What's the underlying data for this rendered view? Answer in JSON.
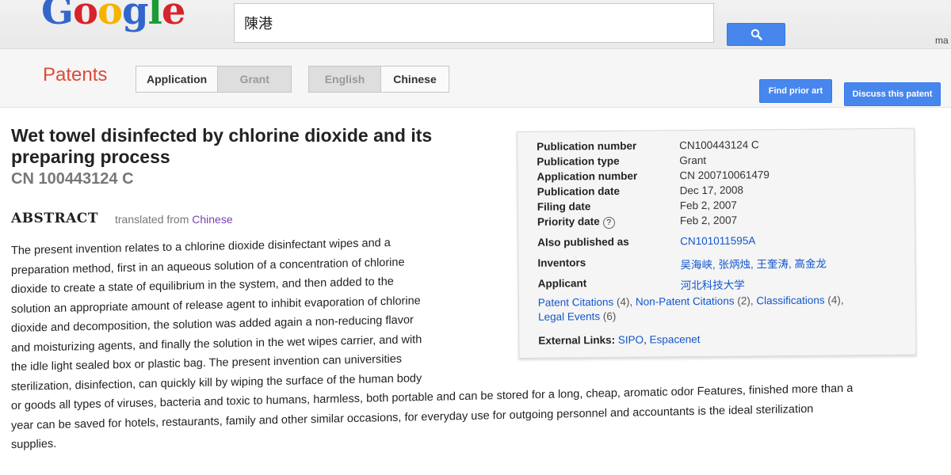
{
  "search": {
    "query": "陳港"
  },
  "header": {
    "user_text": "ma"
  },
  "subnav": {
    "section_title": "Patents",
    "doc_type_tabs": [
      "Application",
      "Grant"
    ],
    "language_tabs": [
      "English",
      "Chinese"
    ],
    "find_prior_art": "Find prior art",
    "discuss": "Discuss this patent"
  },
  "patent": {
    "title": "Wet towel disinfected by chlorine dioxide and its preparing process",
    "number": "CN 100443124 C",
    "abstract_heading": "ABSTRACT",
    "translated_from": "translated from",
    "source_language": "Chinese",
    "abstract_lines": [
      "The present invention relates to a chlorine dioxide disinfectant wipes and a",
      "preparation method, first in an aqueous solution of a concentration of chlorine",
      "dioxide to create a state of equilibrium in the system, and then added to the",
      "solution an appropriate amount of release agent to inhibit evaporation of chlorine",
      "dioxide and decomposition, the solution was added again a non-reducing flavor",
      "and moisturizing agents, and finally the solution in the wet wipes carrier, and with",
      "the idle light sealed box or plastic bag. The present invention can universities",
      "sterilization, disinfection, can quickly kill by wiping the surface of the human body",
      "or goods all types of viruses, bacteria and toxic to humans, harmless, both portable and can be stored for a long, cheap, aromatic odor Features, finished more than a",
      "year can be saved for hotels, restaurants, family and other similar occasions, for everyday use for outgoing personnel and accountants is the ideal sterilization",
      "supplies."
    ]
  },
  "info": {
    "rows": [
      {
        "key": "Publication number",
        "value": "CN100443124 C"
      },
      {
        "key": "Publication type",
        "value": "Grant"
      },
      {
        "key": "Application number",
        "value": "CN 200710061479"
      },
      {
        "key": "Publication date",
        "value": "Dec 17, 2008"
      },
      {
        "key": "Filing date",
        "value": "Feb 2, 2007"
      },
      {
        "key": "Priority date",
        "value": "Feb 2, 2007",
        "help": "?"
      },
      {
        "key": "Also published as",
        "value": "CN101011595A"
      },
      {
        "key": "Inventors",
        "value": "吴海峡, 张炳烛, 王奎涛, 高金龙"
      },
      {
        "key": "Applicant",
        "value": "河北科技大学"
      }
    ],
    "citations": {
      "patent_citations": "Patent Citations",
      "patent_citations_count": "(4),",
      "non_patent_citations": "Non-Patent Citations",
      "non_patent_citations_count": "(2),",
      "classifications": "Classifications",
      "classifications_count": "(4),",
      "legal_events": "Legal Events",
      "legal_events_count": "(6)"
    },
    "external": {
      "label": "External Links:",
      "sipo": "SIPO",
      "espacenet": "Espacenet"
    }
  },
  "colors": {
    "accent_blue": "#4787ed",
    "link": "#1155cc",
    "patents_red": "#dd4b39",
    "visited": "#7b3fb3"
  }
}
